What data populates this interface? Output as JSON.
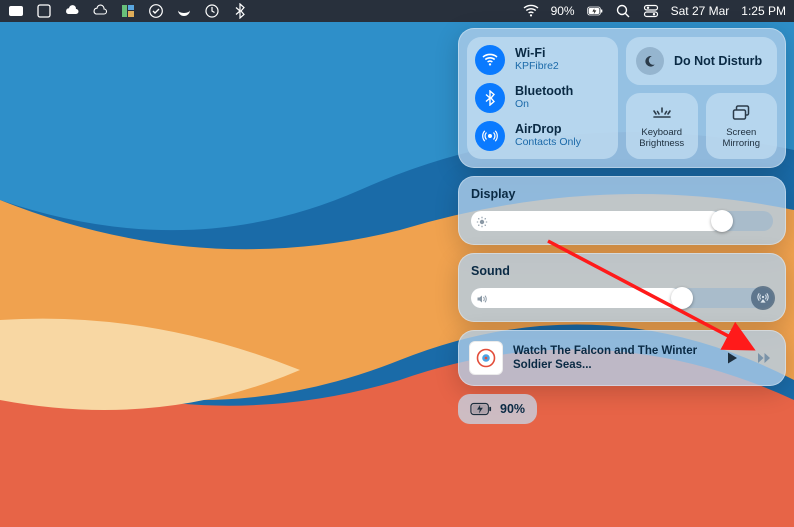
{
  "menubar": {
    "battery_percent": "90%",
    "date": "Sat 27 Mar",
    "time": "1:25 PM"
  },
  "control_center": {
    "wifi": {
      "title": "Wi-Fi",
      "status": "KPFibre2"
    },
    "bluetooth": {
      "title": "Bluetooth",
      "status": "On"
    },
    "airdrop": {
      "title": "AirDrop",
      "status": "Contacts Only"
    },
    "dnd": {
      "title": "Do Not Disturb"
    },
    "keyboard_brightness": {
      "label": "Keyboard Brightness"
    },
    "screen_mirroring": {
      "label": "Screen Mirroring"
    },
    "display": {
      "title": "Display",
      "value_percent": 83
    },
    "sound": {
      "title": "Sound",
      "value_percent": 70
    },
    "media": {
      "title": "Watch The Falcon and The Winter Soldier Seas..."
    },
    "battery": {
      "label": "90%"
    }
  }
}
